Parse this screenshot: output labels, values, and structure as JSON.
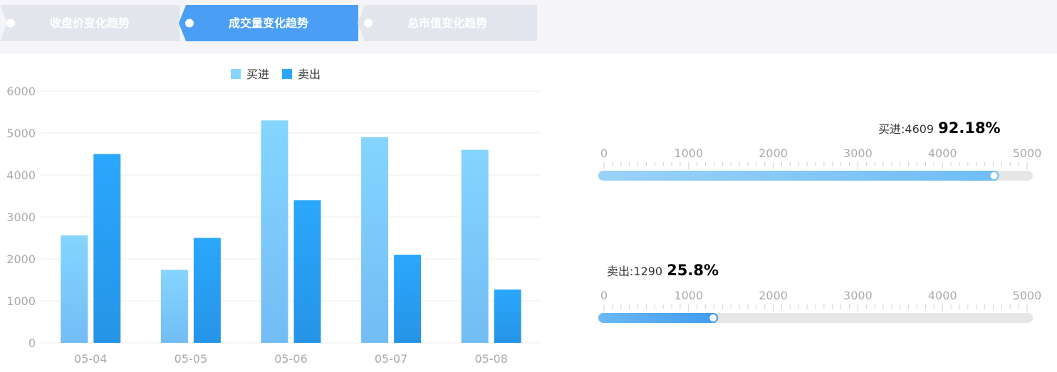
{
  "tabs": [
    {
      "label": "收盘价变化趋势",
      "active": false
    },
    {
      "label": "成交量变化趋势",
      "active": true
    },
    {
      "label": "总市值变化趋势",
      "active": false
    }
  ],
  "colors": {
    "tab_active": "#4a9ff5",
    "tab_inactive": "#e3e5ec",
    "buy_top": "#85d5ff",
    "buy_bottom": "#72bcf4",
    "sell_top": "#2aa7fd",
    "sell_bottom": "#2694e6",
    "axis_text": "#aaaaaa",
    "track": "#e6e6e6"
  },
  "chart_data": [
    {
      "type": "bar",
      "categories": [
        "05-04",
        "05-05",
        "05-06",
        "05-07",
        "05-08"
      ],
      "series": [
        {
          "name": "买进",
          "values": [
            2560,
            1740,
            5300,
            4900,
            4600
          ]
        },
        {
          "name": "卖出",
          "values": [
            4500,
            2500,
            3400,
            2100,
            1270
          ]
        }
      ],
      "ylim": [
        0,
        6000
      ],
      "yticks": [
        0,
        1000,
        2000,
        3000,
        4000,
        5000,
        6000
      ],
      "legend": "top-center",
      "grid": true
    }
  ],
  "gauges": [
    {
      "label": "买进:4609",
      "value": 4609,
      "percent": "92.18%",
      "fill": [
        "#9ad2fb",
        "#6fbdf5"
      ]
    },
    {
      "label": "卖出:1290",
      "value": 1290,
      "percent": "25.8%",
      "fill": [
        "#6cb8f5",
        "#3f9cf0"
      ]
    }
  ],
  "gauge_axis": {
    "min": 0,
    "max": 5000,
    "ticks": [
      0,
      1000,
      2000,
      3000,
      4000,
      5000
    ]
  }
}
